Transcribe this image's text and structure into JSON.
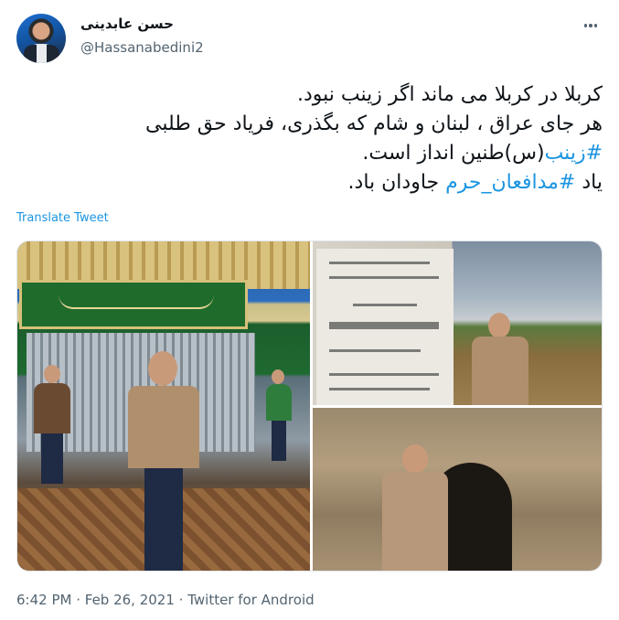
{
  "user": {
    "display_name": "حسن عابدینی",
    "handle": "@Hassanabedini2"
  },
  "tweet": {
    "line1": "کربلا در کربلا می ماند اگر زینب نبود.",
    "line2": "هر جای عراق ، لبنان و شام که بگذری، فریاد حق طلبی",
    "line3_hashtag": "#زینب",
    "line3_text": "(س)طنین انداز است.",
    "line4_prefix": "یاد ",
    "line4_hashtag": "#مدافعان_حرم",
    "line4_suffix": " جاودان باد."
  },
  "translate_label": "Translate Tweet",
  "footer": {
    "time": "6:42 PM",
    "sep": " · ",
    "date": "Feb 26, 2021",
    "sep2": " · ",
    "source": "Twitter for Android"
  },
  "colors": {
    "link": "#1b95e0",
    "secondary": "#536471",
    "text": "#0f1419"
  },
  "icons": {
    "more": "more-horizontal-icon"
  }
}
